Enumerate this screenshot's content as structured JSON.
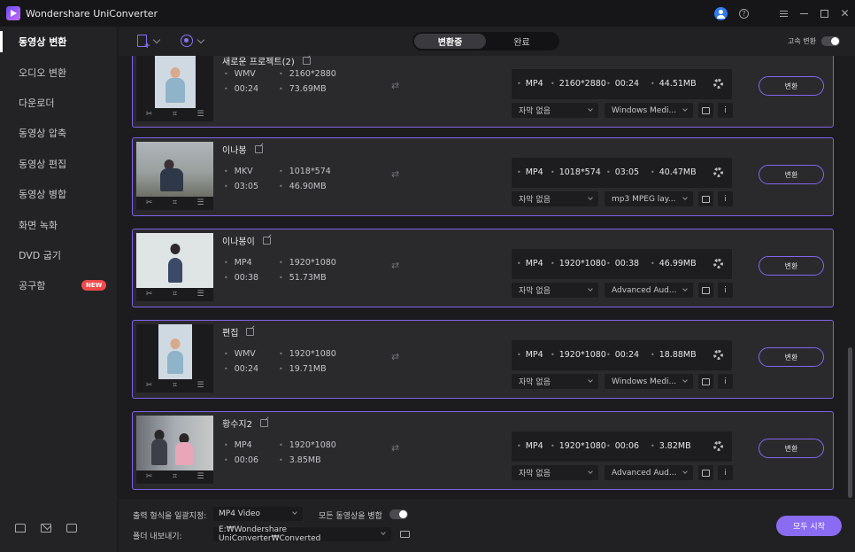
{
  "app": {
    "title": "Wondershare UniConverter"
  },
  "sidebar": {
    "items": [
      {
        "label": "동영상 변환",
        "active": true
      },
      {
        "label": "오디오 변환"
      },
      {
        "label": "다운로더"
      },
      {
        "label": "동영상 압축"
      },
      {
        "label": "동영상 편집"
      },
      {
        "label": "동영상 병합"
      },
      {
        "label": "화면 녹화"
      },
      {
        "label": "DVD 굽기"
      },
      {
        "label": "공구함",
        "badge": "NEW"
      }
    ]
  },
  "toolbar": {
    "tabs": [
      {
        "label": "변환중",
        "active": true
      },
      {
        "label": "완료"
      }
    ],
    "high_speed_label": "고속 변환"
  },
  "files": [
    {
      "title": "새로운 프로젝트(2)",
      "src": {
        "format": "WMV",
        "resolution": "2160*2880",
        "duration": "00:24",
        "size": "73.69MB"
      },
      "out": {
        "format": "MP4",
        "resolution": "2160*2880",
        "duration": "00:24",
        "size": "44.51MB"
      },
      "subtitle": "자막 없음",
      "audio": "Windows Medi...",
      "convert_label": "변환"
    },
    {
      "title": "이나봉",
      "src": {
        "format": "MKV",
        "resolution": "1018*574",
        "duration": "03:05",
        "size": "46.90MB"
      },
      "out": {
        "format": "MP4",
        "resolution": "1018*574",
        "duration": "03:05",
        "size": "40.47MB"
      },
      "subtitle": "자막 없음",
      "audio": "mp3 MPEG lay...",
      "convert_label": "변환"
    },
    {
      "title": "이나봉이",
      "src": {
        "format": "MP4",
        "resolution": "1920*1080",
        "duration": "00:38",
        "size": "51.73MB"
      },
      "out": {
        "format": "MP4",
        "resolution": "1920*1080",
        "duration": "00:38",
        "size": "46.99MB"
      },
      "subtitle": "자막 없음",
      "audio": "Advanced Aud...",
      "convert_label": "변환"
    },
    {
      "title": "편집",
      "src": {
        "format": "WMV",
        "resolution": "1920*1080",
        "duration": "00:24",
        "size": "19.71MB"
      },
      "out": {
        "format": "MP4",
        "resolution": "1920*1080",
        "duration": "00:24",
        "size": "18.88MB"
      },
      "subtitle": "자막 없음",
      "audio": "Windows Medi...",
      "convert_label": "변환"
    },
    {
      "title": "황수지2",
      "src": {
        "format": "MP4",
        "resolution": "1920*1080",
        "duration": "00:06",
        "size": "3.85MB"
      },
      "out": {
        "format": "MP4",
        "resolution": "1920*1080",
        "duration": "00:06",
        "size": "3.82MB"
      },
      "subtitle": "자막 없음",
      "audio": "Advanced Aud...",
      "convert_label": "변환"
    }
  ],
  "footer": {
    "output_format_label": "출력 형식을 일괄지정:",
    "output_format_value": "MP4 Video",
    "merge_label": "모든 동영상을 병합",
    "export_folder_label": "폴더 내보내기:",
    "export_folder_value": "E:₩Wondershare UniConverter₩Converted",
    "start_all_label": "모두 시작"
  },
  "colors": {
    "accent": "#8062e6",
    "accent_button": "#8a6cf2",
    "badge_new": "#ef4a4a",
    "user_icon": "#2f7bf0"
  }
}
